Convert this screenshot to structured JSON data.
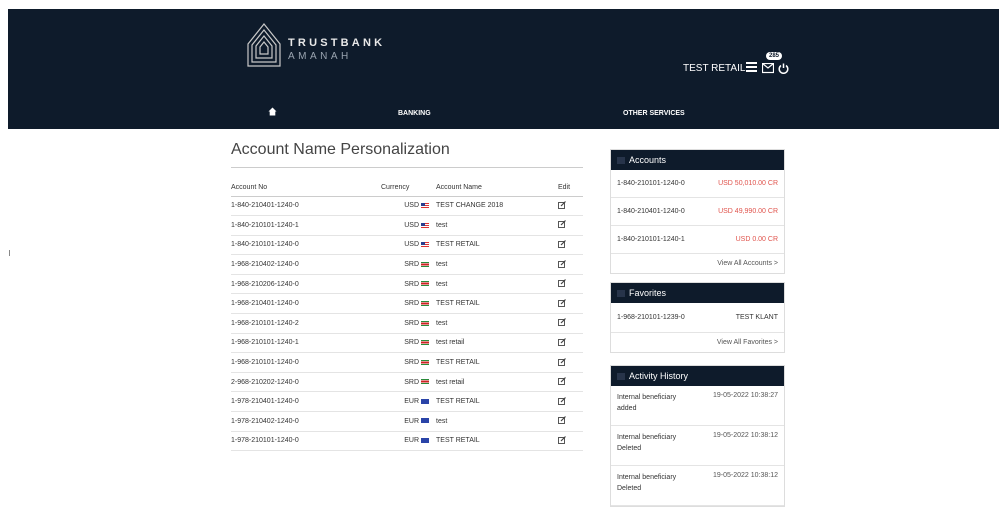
{
  "brand": {
    "line1": "TRUSTBANK",
    "line2": "AMANAH"
  },
  "header": {
    "user_name": "TEST RETAIL",
    "notification_count": "285"
  },
  "nav": {
    "banking": "BANKING",
    "other_services": "OTHER SERVICES"
  },
  "page": {
    "title": "Account Name Personalization"
  },
  "table": {
    "headers": {
      "account_no": "Account No",
      "currency": "Currency",
      "account_name": "Account Name",
      "edit": "Edit"
    },
    "rows": [
      {
        "account_no": "1-840-210401-1240-0",
        "currency": "USD",
        "account_name": "TEST CHANGE 2018"
      },
      {
        "account_no": "1-840-210101-1240-1",
        "currency": "USD",
        "account_name": "test"
      },
      {
        "account_no": "1-840-210101-1240-0",
        "currency": "USD",
        "account_name": "TEST RETAIL"
      },
      {
        "account_no": "1-968-210402-1240-0",
        "currency": "SRD",
        "account_name": "test"
      },
      {
        "account_no": "1-968-210206-1240-0",
        "currency": "SRD",
        "account_name": "test"
      },
      {
        "account_no": "1-968-210401-1240-0",
        "currency": "SRD",
        "account_name": "TEST RETAIL"
      },
      {
        "account_no": "1-968-210101-1240-2",
        "currency": "SRD",
        "account_name": "test"
      },
      {
        "account_no": "1-968-210101-1240-1",
        "currency": "SRD",
        "account_name": "test retail"
      },
      {
        "account_no": "1-968-210101-1240-0",
        "currency": "SRD",
        "account_name": "TEST RETAIL"
      },
      {
        "account_no": "2-968-210202-1240-0",
        "currency": "SRD",
        "account_name": "test retail"
      },
      {
        "account_no": "1-978-210401-1240-0",
        "currency": "EUR",
        "account_name": "TEST RETAIL"
      },
      {
        "account_no": "1-978-210402-1240-0",
        "currency": "EUR",
        "account_name": "test"
      },
      {
        "account_no": "1-978-210101-1240-0",
        "currency": "EUR",
        "account_name": "TEST RETAIL"
      }
    ]
  },
  "accounts_panel": {
    "title": "Accounts",
    "items": [
      {
        "account": "1-840-210101-1240-0",
        "amount": "USD 50,010.00 CR"
      },
      {
        "account": "1-840-210401-1240-0",
        "amount": "USD 49,990.00 CR"
      },
      {
        "account": "1-840-210101-1240-1",
        "amount": "USD 0.00 CR"
      }
    ],
    "link": "View All Accounts >"
  },
  "favorites_panel": {
    "title": "Favorites",
    "items": [
      {
        "account": "1-968-210101-1239-0",
        "name": "TEST KLANT"
      }
    ],
    "link": "View All Favorites >"
  },
  "activity_panel": {
    "title": "Activity History",
    "items": [
      {
        "desc": "Internal beneficiary added",
        "time": "19-05-2022 10:38:27"
      },
      {
        "desc": "Internal beneficiary Deleted",
        "time": "19-05-2022 10:38:12"
      },
      {
        "desc": "Internal beneficiary Deleted",
        "time": "19-05-2022 10:38:12"
      }
    ]
  },
  "colors": {
    "header_bg": "#0e1b2b",
    "amount_red": "#e0544d"
  }
}
